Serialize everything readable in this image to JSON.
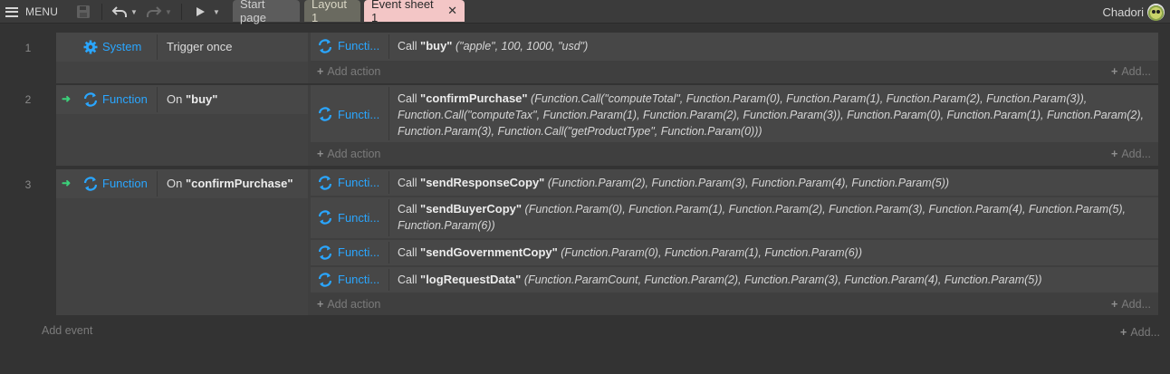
{
  "topbar": {
    "menu_label": "MENU",
    "tabs": [
      "Start page",
      "Layout 1",
      "Event sheet 1"
    ],
    "close_glyph": "✕",
    "user": "Chadori",
    "icons": [
      "menu-icon",
      "save-icon",
      "undo-icon",
      "redo-icon",
      "play-icon"
    ]
  },
  "colors": {
    "object": "#2aa6ff",
    "trigger_arrow": "#3bd17a",
    "active_tab": "#f3c6c6"
  },
  "events": [
    {
      "number": "1",
      "condition": {
        "object": "System",
        "icon": "gear-icon",
        "text": "Trigger once",
        "param": ""
      },
      "actions": [
        {
          "object": "Functi...",
          "call": "Call",
          "name": "\"buy\"",
          "params": "(\"apple\", 100, 1000, \"usd\")"
        }
      ]
    },
    {
      "number": "2",
      "condition": {
        "object": "Function",
        "icon": "function-icon",
        "text": "On",
        "param": "\"buy\""
      },
      "actions": [
        {
          "object": "Functi...",
          "call": "Call",
          "name": "\"confirmPurchase\"",
          "params": "(Function.Call(\"computeTotal\", Function.Param(0), Function.Param(1), Function.Param(2), Function.Param(3)), Function.Call(\"computeTax\", Function.Param(1), Function.Param(2), Function.Param(3)), Function.Param(0), Function.Param(1), Function.Param(2), Function.Param(3), Function.Call(\"getProductType\", Function.Param(0)))"
        }
      ]
    },
    {
      "number": "3",
      "condition": {
        "object": "Function",
        "icon": "function-icon",
        "text": "On",
        "param": "\"confirmPurchase\""
      },
      "actions": [
        {
          "object": "Functi...",
          "call": "Call",
          "name": "\"sendResponseCopy\"",
          "params": "(Function.Param(2), Function.Param(3), Function.Param(4), Function.Param(5))"
        },
        {
          "object": "Functi...",
          "call": "Call",
          "name": "\"sendBuyerCopy\"",
          "params": "(Function.Param(0), Function.Param(1), Function.Param(2), Function.Param(3), Function.Param(4), Function.Param(5), Function.Param(6))"
        },
        {
          "object": "Functi...",
          "call": "Call",
          "name": "\"sendGovernmentCopy\"",
          "params": "(Function.Param(0), Function.Param(1), Function.Param(6))"
        },
        {
          "object": "Functi...",
          "call": "Call",
          "name": "\"logRequestData\"",
          "params": "(Function.ParamCount, Function.Param(2), Function.Param(3), Function.Param(4), Function.Param(5))"
        }
      ]
    }
  ],
  "add_action_label": "Add action",
  "add_short_label": "Add...",
  "add_event_label": "Add event",
  "plus_glyph": "+"
}
